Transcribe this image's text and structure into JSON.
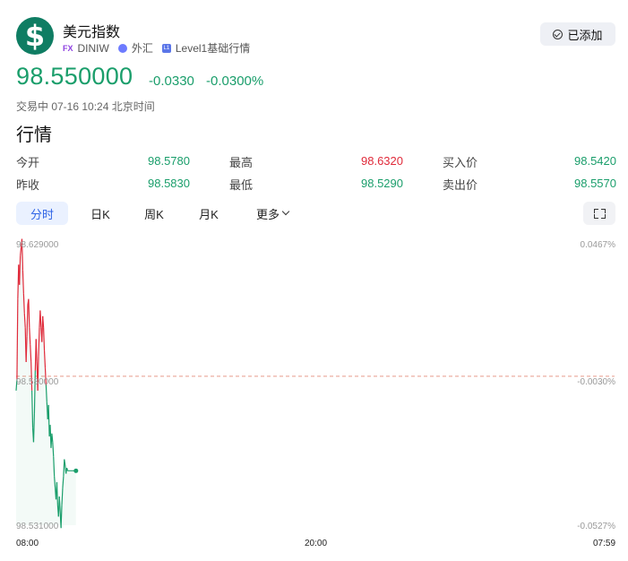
{
  "header": {
    "logo_symbol": "$",
    "title": "美元指数",
    "tags": [
      {
        "icon": "fx-badge",
        "text": "DINIW",
        "prefix": "FX"
      },
      {
        "icon": "globe-icon",
        "text": "外汇"
      },
      {
        "icon": "level1-icon",
        "text": "Level1基础行情",
        "prefix": "L1"
      }
    ],
    "added_button": "已添加"
  },
  "quote": {
    "price": "98.550000",
    "change": "-0.0330",
    "change_pct": "-0.0300%",
    "status": "交易中 07-16 10:24 北京时间"
  },
  "market": {
    "title": "行情",
    "rows": [
      [
        {
          "label": "今开",
          "value": "98.5780",
          "color": "green"
        },
        {
          "label": "最高",
          "value": "98.6320",
          "color": "red"
        },
        {
          "label": "买入价",
          "value": "98.5420",
          "color": "green"
        }
      ],
      [
        {
          "label": "昨收",
          "value": "98.5830",
          "color": "green"
        },
        {
          "label": "最低",
          "value": "98.5290",
          "color": "green"
        },
        {
          "label": "卖出价",
          "value": "98.5570",
          "color": "green"
        }
      ]
    ]
  },
  "tabs": [
    "分时",
    "日K",
    "周K",
    "月K",
    "更多"
  ],
  "active_tab": "分时",
  "colors": {
    "up": "#e02a3a",
    "down": "#1a9e6b",
    "accent": "#2e64e6",
    "baseline": "#e89a8a"
  },
  "chart_data": {
    "type": "line",
    "y_left_labels": [
      "98.629000",
      "98.580000",
      "98.531000"
    ],
    "y_right_labels": [
      "0.0467%",
      "-0.0030%",
      "-0.0527%"
    ],
    "x_labels": [
      "08:00",
      "20:00",
      "07:59"
    ],
    "ylim": [
      98.531,
      98.629
    ],
    "previous_close": 98.583,
    "grid": false,
    "series": [
      {
        "x": [
          "08:00",
          "08:02",
          "08:04",
          "08:06",
          "08:08",
          "08:10",
          "08:12",
          "08:14",
          "08:16",
          "08:18",
          "08:20",
          "08:22",
          "08:24",
          "08:26",
          "08:28",
          "08:30",
          "08:32",
          "08:34",
          "08:36",
          "08:38",
          "08:40",
          "08:42",
          "08:44",
          "08:46",
          "08:48",
          "08:50",
          "08:52",
          "08:54",
          "08:56",
          "08:58",
          "09:00",
          "09:02",
          "09:04",
          "09:06",
          "09:08",
          "09:10",
          "09:12",
          "09:14",
          "09:16",
          "09:18",
          "09:20",
          "09:22",
          "09:24",
          "09:26",
          "09:28",
          "09:30",
          "09:32",
          "09:34",
          "09:36",
          "09:38",
          "09:40",
          "09:42",
          "09:44",
          "09:46",
          "09:48",
          "09:50",
          "09:52",
          "09:54",
          "09:56",
          "09:58",
          "10:00",
          "10:02",
          "10:04",
          "10:06",
          "10:08",
          "10:10",
          "10:12",
          "10:14",
          "10:16",
          "10:18",
          "10:20",
          "10:22",
          "10:24"
        ],
        "values": [
          98.578,
          98.582,
          98.61,
          98.622,
          98.615,
          98.625,
          98.628,
          98.631,
          98.62,
          98.612,
          98.605,
          98.6,
          98.588,
          98.597,
          98.608,
          98.61,
          98.6,
          98.594,
          98.588,
          98.578,
          98.565,
          98.56,
          98.57,
          98.585,
          98.596,
          98.588,
          98.578,
          98.59,
          98.6,
          98.606,
          98.6,
          98.595,
          98.604,
          98.6,
          98.592,
          98.586,
          98.58,
          98.574,
          98.568,
          98.573,
          98.562,
          98.566,
          98.558,
          98.563,
          98.56,
          98.555,
          98.548,
          98.544,
          98.54,
          98.546,
          98.538,
          98.534,
          98.541,
          98.536,
          98.53,
          98.538,
          98.544,
          98.548,
          98.554,
          98.552,
          98.549,
          98.551,
          98.55,
          98.55,
          98.55,
          98.55,
          98.55,
          98.55,
          98.55,
          98.55,
          98.55,
          98.55,
          98.55
        ]
      }
    ]
  }
}
